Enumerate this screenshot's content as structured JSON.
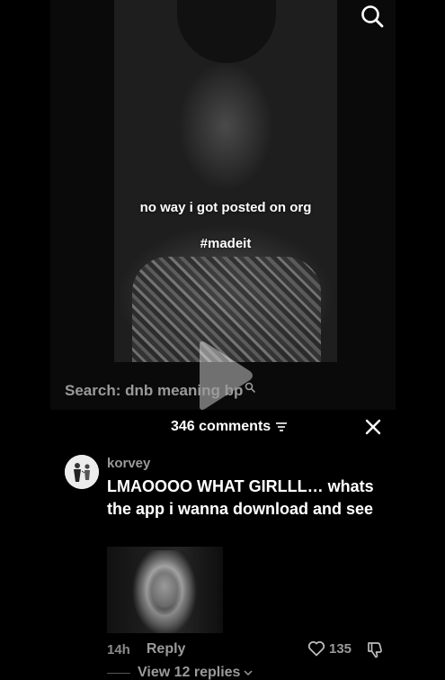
{
  "video": {
    "caption_line1": "no way i got posted on org",
    "caption_line2": "#madeit"
  },
  "search_suggestion": {
    "text": "Search: dnb meaning bp"
  },
  "comments": {
    "header": "346 comments",
    "items": [
      {
        "username": "korvey",
        "text": "LMAOOOO WHAT GIRLLL… whats the app i wanna download and see",
        "time": "14h",
        "reply_label": "Reply",
        "likes": "135",
        "view_replies": "View 12 replies"
      }
    ]
  },
  "icons": {
    "top_search": "search-icon",
    "play": "play-icon",
    "sort": "sort-icon",
    "close": "close-icon",
    "like": "heart-icon",
    "dislike": "thumbs-down-icon",
    "expand": "chevron-down-icon"
  },
  "colors": {
    "background": "#000000",
    "primary_text": "#ffffff",
    "secondary_text": "#9a9a9a"
  }
}
